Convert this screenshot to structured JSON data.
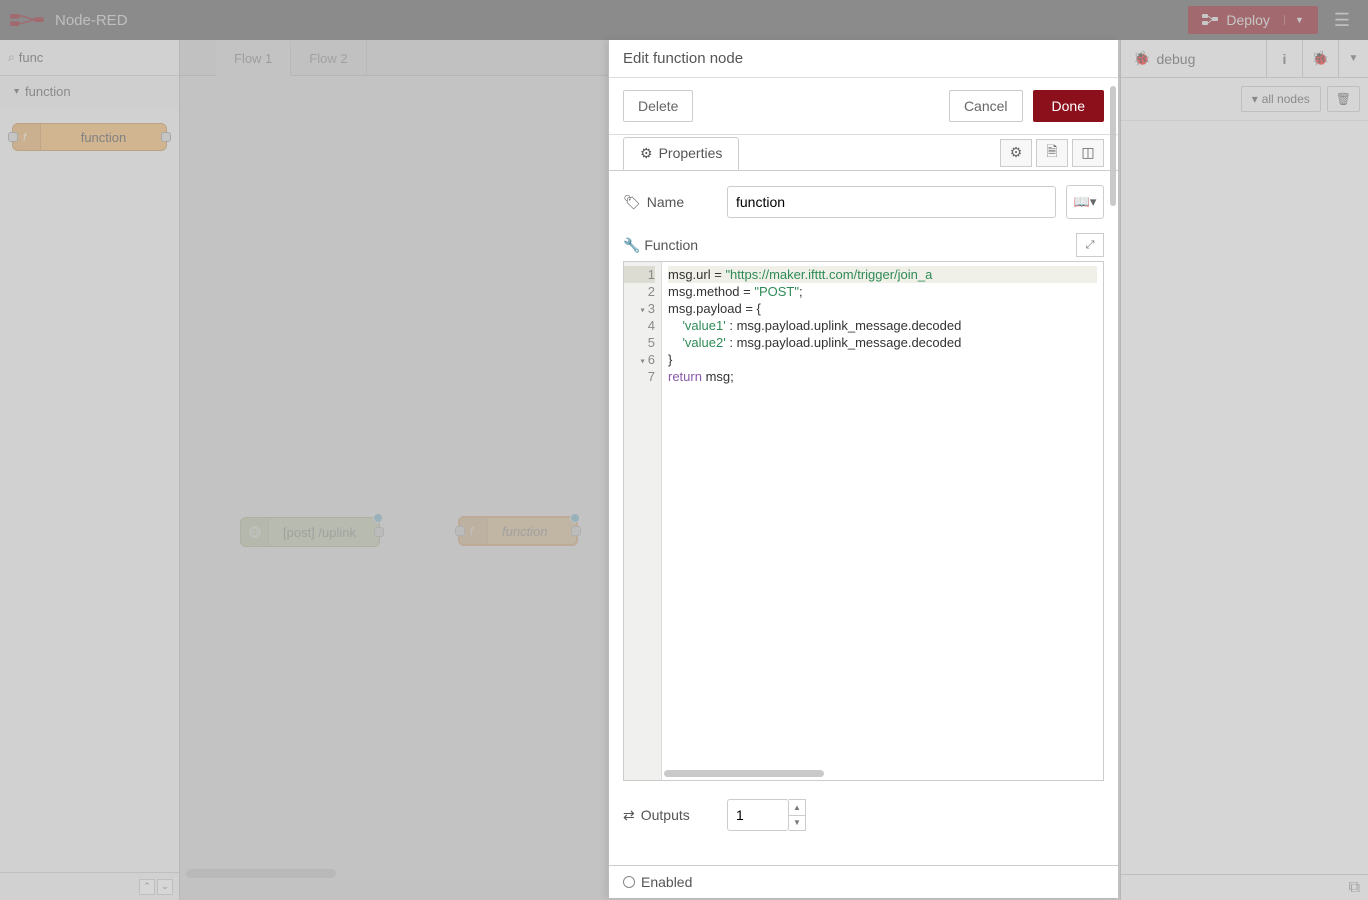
{
  "header": {
    "title": "Node-RED",
    "deploy_label": "Deploy"
  },
  "palette": {
    "search_value": "func",
    "category": "function",
    "node_label": "function"
  },
  "workspace": {
    "tabs": [
      "Flow 1",
      "Flow 2"
    ],
    "active_tab": 0,
    "nodes": {
      "http": "[post] /uplink",
      "func": "function"
    }
  },
  "tray": {
    "title": "Edit function node",
    "buttons": {
      "delete": "Delete",
      "cancel": "Cancel",
      "done": "Done"
    },
    "prop_tab": "Properties",
    "name_label": "Name",
    "name_value": "function",
    "function_label": "Function",
    "outputs_label": "Outputs",
    "outputs_value": "1",
    "enabled_label": "Enabled",
    "code": {
      "l1a": "msg.url = ",
      "l1b": "\"https://maker.ifttt.com/trigger/join_a",
      "l2a": "msg.method = ",
      "l2b": "\"POST\"",
      "l2c": ";",
      "l3": "msg.payload = {",
      "l4a": "    ",
      "l4b": "'value1'",
      "l4c": " : msg.payload.uplink_message.decoded",
      "l5a": "    ",
      "l5b": "'value2'",
      "l5c": " : msg.payload.uplink_message.decoded",
      "l6": "}",
      "l7a": "return",
      "l7b": " msg;"
    }
  },
  "sidebar": {
    "tab_label": "debug",
    "filter_label": "all nodes"
  }
}
